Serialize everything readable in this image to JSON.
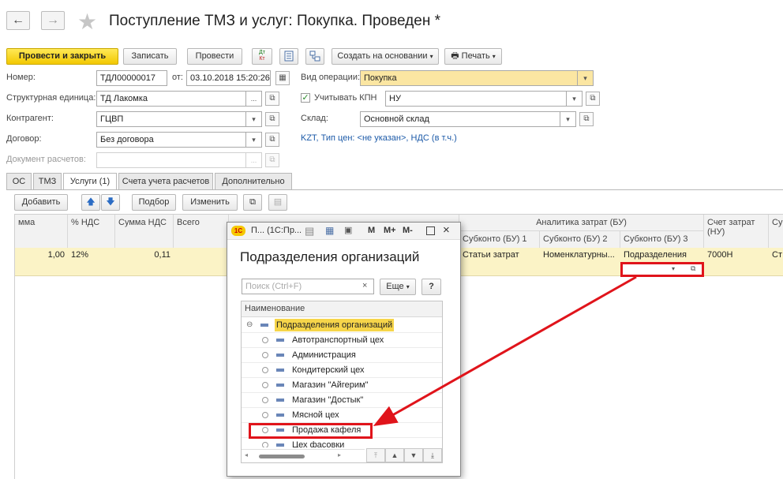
{
  "header": {
    "title": "Поступление ТМЗ и услуг: Покупка. Проведен *",
    "back_icon": "←",
    "forward_icon": "→",
    "star_icon": "★"
  },
  "toolbar": {
    "post_close": "Провести и закрыть",
    "save": "Записать",
    "post": "Провести",
    "dtkt_icon_top": "Дт",
    "dtkt_icon_bottom": "Кт",
    "create_basis": "Создать на основании",
    "print": "Печать"
  },
  "form": {
    "number_label": "Номер:",
    "number_value": "ТДЛ00000017",
    "date_label": "от:",
    "date_value": "03.10.2018 15:20:26",
    "operation_label": "Вид операции:",
    "operation_value": "Покупка",
    "unit_label": "Структурная единица:",
    "unit_value": "ТД Лакомка",
    "kpn_label": "Учитывать КПН",
    "kpn_value": "НУ",
    "counterparty_label": "Контрагент:",
    "counterparty_value": "ГЦВП",
    "warehouse_label": "Склад:",
    "warehouse_value": "Основной склад",
    "contract_label": "Договор:",
    "contract_value": "Без договора",
    "settlement_label": "Документ расчетов:",
    "prices_link": "KZT, Тип цен: <не указан>, НДС (в т.ч.)"
  },
  "tabs": [
    "ОС",
    "ТМЗ",
    "Услуги (1)",
    "Счета учета расчетов",
    "Дополнительно"
  ],
  "table_toolbar": {
    "add": "Добавить",
    "select": "Подбор",
    "change": "Изменить"
  },
  "table": {
    "headers": {
      "sum": "мма",
      "vat_pct": "% НДС",
      "vat_sum": "Сумма НДС",
      "total": "Всего",
      "analytics_group": "Аналитика затрат (БУ)",
      "subkonto1": "Субконто (БУ) 1",
      "subkonto2": "Субконто (БУ) 2",
      "subkonto3": "Субконто (БУ) 3",
      "account_nu": "Счет затрат (НУ)",
      "extra": "Су"
    },
    "row": {
      "sum": "1,00",
      "vat_pct": "12%",
      "vat_sum": "0,11",
      "subkonto1": "Статьи затрат",
      "subkonto2": "Номенклатурны...",
      "subkonto3": "Подразделения",
      "account_nu": "7000Н",
      "extra": "Ст"
    }
  },
  "popup": {
    "titlebar": "П... (1С:Пр...",
    "title": "Подразделения организаций",
    "search_placeholder": "Поиск (Ctrl+F)",
    "more": "Еще",
    "help": "?",
    "column": "Наименование",
    "root": "Подразделения организаций",
    "items": [
      "Автотранспортный цех",
      "Администрация",
      "Кондитерский цех",
      "Магазин \"Айгерим\"",
      "Магазин \"Достык\"",
      "Мясной цех",
      "Продажа кафеля",
      "Цех фасовки"
    ]
  },
  "colors": {
    "accent_yellow": "#f2c800",
    "selected_row": "#fbf3c6",
    "highlight_red": "#e0141b"
  }
}
